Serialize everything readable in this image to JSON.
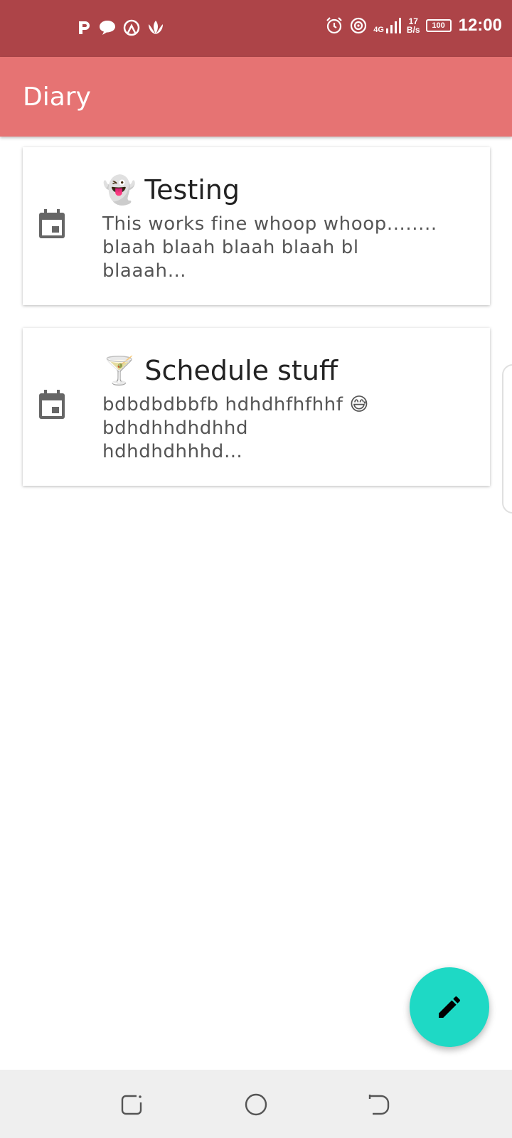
{
  "status_bar": {
    "left_icons": [
      "p-app-icon",
      "chat-bubble-icon",
      "hotspot-icon",
      "lotus-icon"
    ],
    "right_icons": [
      "alarm-icon",
      "hotspot-icon",
      "signal-4g-icon",
      "battery-icon"
    ],
    "network_type": "4G",
    "net_speed_value": "17",
    "net_speed_unit": "B/s",
    "battery_level": "100",
    "time": "12:00",
    "background_color": "#ad4448"
  },
  "app_bar": {
    "title": "Diary",
    "background_color": "#e67373"
  },
  "entries": [
    {
      "emoji": "👻",
      "title": "Testing",
      "preview_line1": "This works fine whoop whoop........",
      "preview_line2": "blaah blaah blaah blaah bl",
      "preview_line3": "blaaah…",
      "icon": "calendar-icon"
    },
    {
      "emoji": "🍸",
      "title": "Schedule stuff",
      "preview_line1": "bdbdbdbbfb hdhdhfhfhhf 😅",
      "preview_line2": "bdhdhhdhdhhd",
      "preview_line3": "hdhdhdhhhd…",
      "icon": "calendar-icon"
    }
  ],
  "fab": {
    "icon": "pencil-icon",
    "color": "#1ed9c5"
  },
  "nav_bar": {
    "buttons": [
      "recent-apps-icon",
      "home-icon",
      "back-icon"
    ],
    "background_color": "#efefef"
  }
}
